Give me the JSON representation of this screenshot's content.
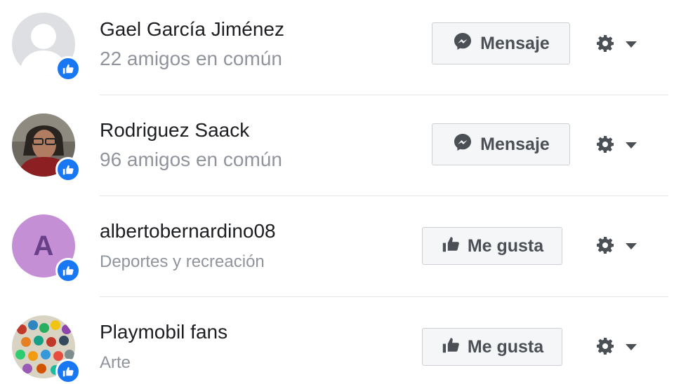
{
  "items": [
    {
      "name": "Gael García Jiménez",
      "subtitle": "22 amigos en común",
      "button_label": "Mensaje",
      "button_type": "message",
      "avatar_type": "default-silhouette",
      "badge_icon": "thumbs-up-icon"
    },
    {
      "name": "Rodriguez Saack",
      "subtitle": "96 amigos en común",
      "button_label": "Mensaje",
      "button_type": "message",
      "avatar_type": "photo",
      "badge_icon": "thumbs-up-icon"
    },
    {
      "name": "albertobernardino08",
      "subtitle": "Deportes y recreación",
      "button_label": "Me gusta",
      "button_type": "like",
      "avatar_type": "letter",
      "avatar_letter": "A",
      "badge_icon": "thumbs-up-icon"
    },
    {
      "name": "Playmobil fans",
      "subtitle": "Arte",
      "button_label": "Me gusta",
      "button_type": "like",
      "avatar_type": "photo",
      "badge_icon": "thumbs-up-icon"
    }
  ],
  "colors": {
    "badge_blue": "#1877f2",
    "letter_avatar_bg": "#c58fd6",
    "letter_avatar_fg": "#6a3f8a",
    "name_text": "#1c1e21",
    "subtitle_text": "#90949c",
    "button_bg": "#f5f6f7",
    "button_text": "#4b4f56"
  }
}
